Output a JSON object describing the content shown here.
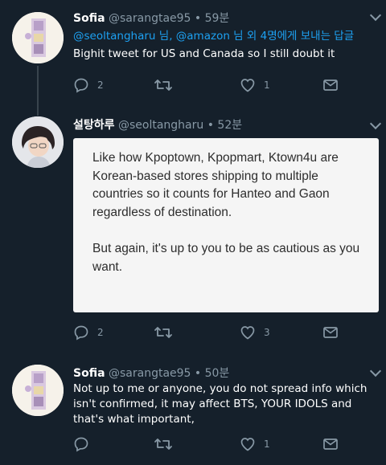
{
  "tweets": [
    {
      "name": "Sofia",
      "handle": "@sarangtae95",
      "time": "• 59분",
      "reply_prefix_mention1": "@seoltangharu",
      "reply_sep1": " 님, ",
      "reply_prefix_mention2": "@amazon",
      "reply_prefix_rest": " 님 외 4명에게 보내는 답글",
      "text": "Bighit tweet for US and Canada so I still doubt it",
      "replies": "2",
      "retweets": "",
      "likes": "1"
    },
    {
      "name": "설탕하루",
      "handle": "@seoltangharu",
      "time": "• 52분",
      "card_para1": "Like how Kpoptown, Kpopmart, Ktown4u are Korean-based stores shipping to multiple countries so it counts for Hanteo and Gaon regardless of destination.",
      "card_para2": "But again, it's up to you to be as cautious as you want.",
      "replies": "2",
      "retweets": "",
      "likes": "3"
    },
    {
      "name": "Sofia",
      "handle": "@sarangtae95",
      "time": "• 50분",
      "text": "Not up to me or anyone, you do not spread info which isn't confirmed, it may affect BTS, YOUR IDOLS and that's what important,",
      "replies": "",
      "retweets": "",
      "likes": "1"
    }
  ],
  "colors": {
    "background": "#15202b",
    "mention": "#1da1f2",
    "muted": "#8899a6",
    "card": "#f5f5f5"
  },
  "icons": [
    "reply-icon",
    "retweet-icon",
    "like-icon",
    "dm-icon",
    "chevron-down-icon"
  ]
}
